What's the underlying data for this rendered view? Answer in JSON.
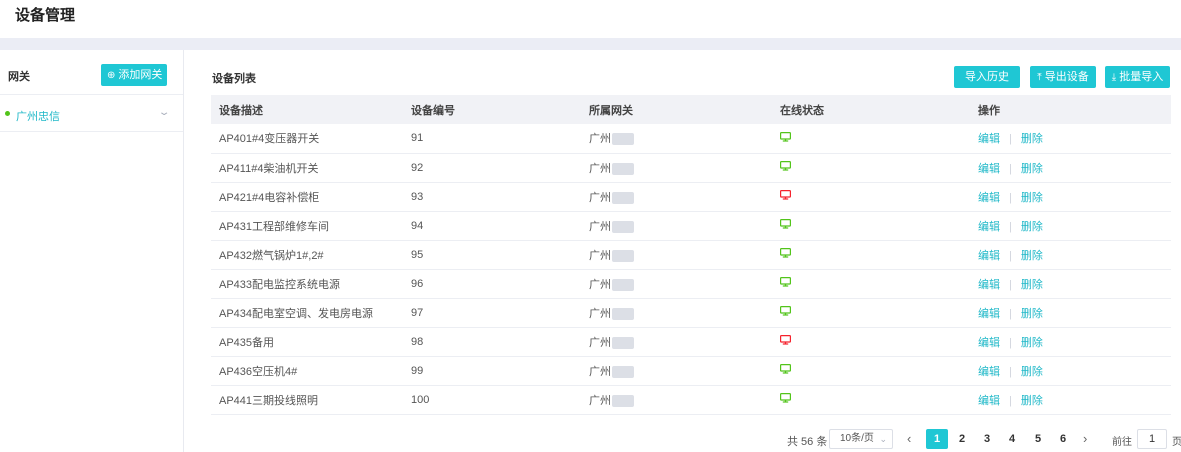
{
  "page": {
    "title": "设备管理"
  },
  "gateway_panel": {
    "title": "网关",
    "add_button": "添加网关",
    "items": [
      {
        "label": "广州忠信",
        "status_color": "#52c41a"
      }
    ]
  },
  "device_list": {
    "title": "设备列表",
    "buttons": {
      "history": "导入历史",
      "export": "导出设备",
      "import": "批量导入"
    },
    "columns": [
      "设备描述",
      "设备编号",
      "所属网关",
      "在线状态",
      "操作"
    ],
    "rows": [
      {
        "description": "AP401#4变压器开关",
        "number": "91",
        "gateway": "广州",
        "online": true
      },
      {
        "description": "AP411#4柴油机开关",
        "number": "92",
        "gateway": "广州",
        "online": true
      },
      {
        "description": "AP421#4电容补偿柜",
        "number": "93",
        "gateway": "广州",
        "online": false
      },
      {
        "description": "AP431工程部维修车间",
        "number": "94",
        "gateway": "广州",
        "online": true
      },
      {
        "description": "AP432燃气锅炉1#,2#",
        "number": "95",
        "gateway": "广州",
        "online": true
      },
      {
        "description": "AP433配电监控系统电源",
        "number": "96",
        "gateway": "广州",
        "online": true
      },
      {
        "description": "AP434配电室空调、发电房电源",
        "number": "97",
        "gateway": "广州",
        "online": true
      },
      {
        "description": "AP435备用",
        "number": "98",
        "gateway": "广州",
        "online": false
      },
      {
        "description": "AP436空压机4#",
        "number": "99",
        "gateway": "广州",
        "online": true
      },
      {
        "description": "AP441三期投线照明",
        "number": "100",
        "gateway": "广州",
        "online": true
      }
    ],
    "actions": {
      "edit": "编辑",
      "delete": "删除"
    },
    "status_colors": {
      "online": "#52c41a",
      "offline": "#f5222d"
    }
  },
  "pagination": {
    "total": "共 56 条",
    "page_size": "10条/页",
    "pages": [
      "1",
      "2",
      "3",
      "4",
      "5",
      "6"
    ],
    "current": "1",
    "goto_label": "前往",
    "goto_value": "1",
    "page_unit": "页"
  },
  "colors": {
    "accent": "#1fc7d4",
    "band": "#ebedf5",
    "header_bg": "#f1f2f6"
  }
}
